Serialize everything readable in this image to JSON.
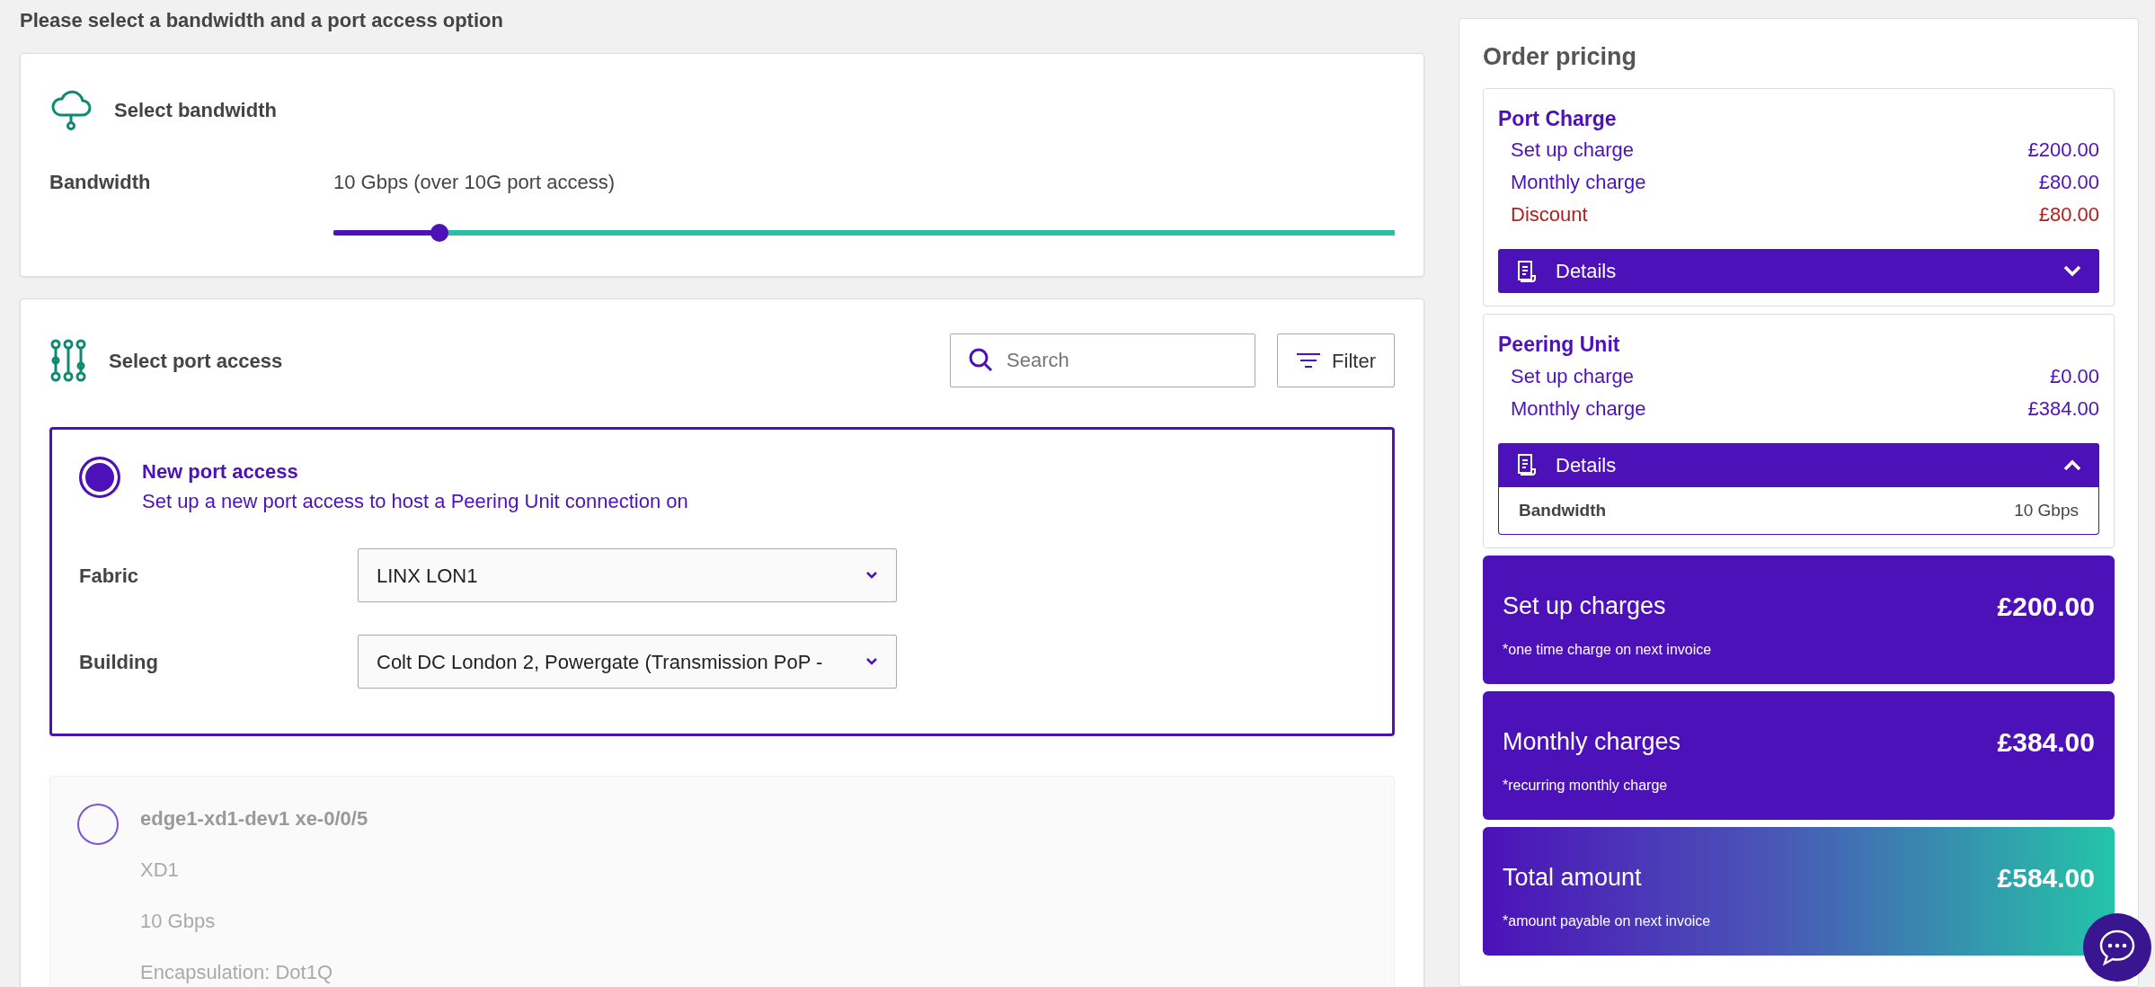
{
  "page_title": "Please select a bandwidth and a port access option",
  "bandwidth": {
    "title": "Select bandwidth",
    "label": "Bandwidth",
    "value": "10 Gbps (over 10G port access)",
    "level": 0.1
  },
  "port_access": {
    "title": "Select port access",
    "search": {
      "placeholder": "Search"
    },
    "filter_button": "Filter",
    "options": [
      {
        "title": "New port access",
        "subtitle": "Set up a new port access to host a Peering Unit connection on",
        "selected": true,
        "fields": [
          {
            "label": "Fabric",
            "value": "LINX LON1"
          },
          {
            "label": "Building",
            "value": "Colt DC London 2, Powergate (Transmission PoP -"
          }
        ]
      },
      {
        "title": "edge1-xd1-dev1 xe-0/0/5",
        "selected": false,
        "lines": [
          "XD1",
          "10 Gbps",
          "Encapsulation: Dot1Q"
        ]
      }
    ]
  },
  "order_pricing": {
    "title": "Order pricing",
    "sections": [
      {
        "title": "Port Charge",
        "items": [
          {
            "kind": "charge",
            "label": "Set up charge",
            "amount": "£200.00"
          },
          {
            "kind": "charge",
            "label": "Monthly charge",
            "amount": "£80.00"
          },
          {
            "kind": "discount",
            "label": "Discount",
            "amount": "£80.00"
          }
        ],
        "details": {
          "label": "Details",
          "expanded": false
        }
      },
      {
        "title": "Peering Unit",
        "items": [
          {
            "kind": "charge",
            "label": "Set up charge",
            "amount": "£0.00"
          },
          {
            "kind": "charge",
            "label": "Monthly charge",
            "amount": "£384.00"
          }
        ],
        "details": {
          "label": "Details",
          "expanded": true,
          "rows": [
            {
              "label": "Bandwidth",
              "value": "10 Gbps"
            }
          ]
        }
      }
    ],
    "summaries": [
      {
        "kind": "plain",
        "title": "Set up charges",
        "amount": "£200.00",
        "note": "*one time charge on next invoice"
      },
      {
        "kind": "plain",
        "title": "Monthly charges",
        "amount": "£384.00",
        "note": "*recurring monthly charge"
      },
      {
        "kind": "total",
        "title": "Total amount",
        "amount": "£584.00",
        "note": "*amount payable on next invoice"
      }
    ]
  }
}
